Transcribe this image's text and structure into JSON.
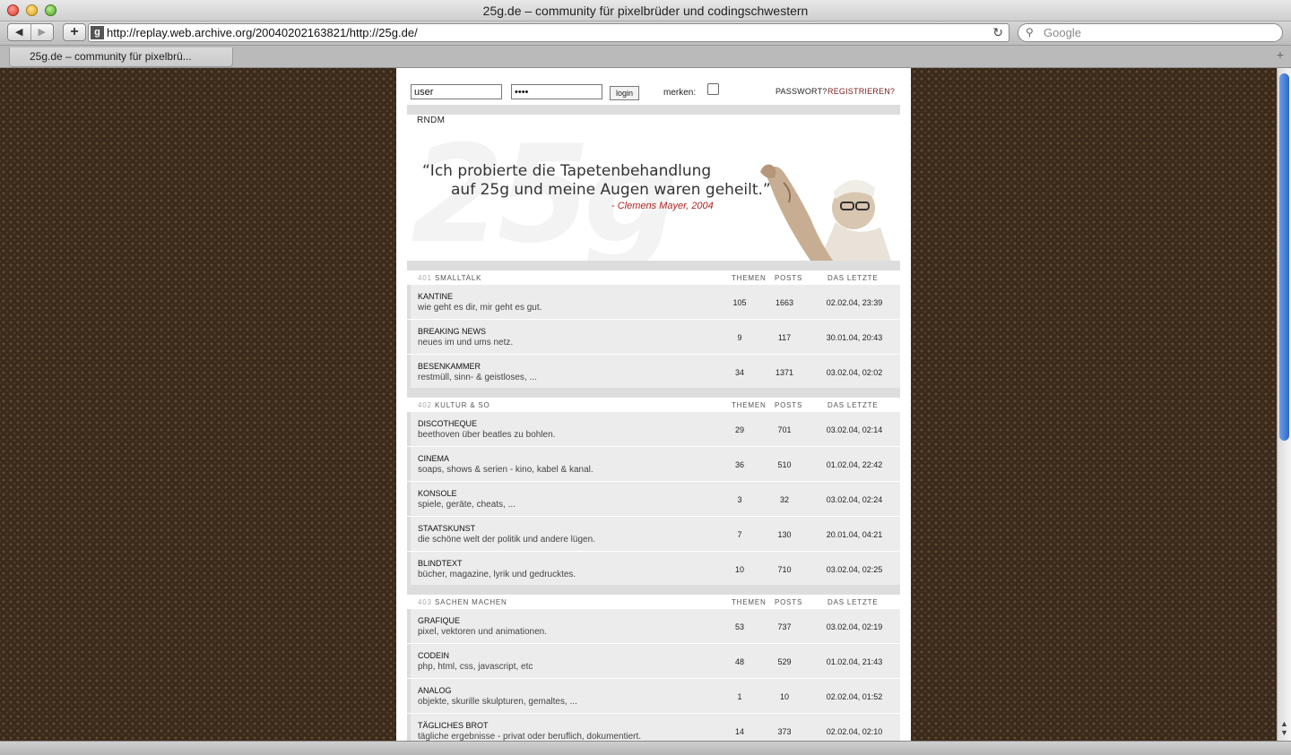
{
  "window": {
    "title": "25g.de – community für pixelbrüder und codingschwestern"
  },
  "toolbar": {
    "back_icon": "◀",
    "forward_icon": "▶",
    "add_icon": "+",
    "favicon": "g",
    "url": "http://replay.web.archive.org/20040202163821/http://25g.de/",
    "reload_icon": "↻",
    "search_icon": "🔍",
    "search_placeholder": "Google"
  },
  "tab": {
    "label": "25g.de – community für pixelbrü...",
    "new_tab_icon": "+"
  },
  "login": {
    "username": "user",
    "password": "••••",
    "login_label": "login",
    "remember_label": "merken:",
    "password_link": "PASSWORT?",
    "register_link": "REGISTRIEREN?"
  },
  "rndm_label": "RNDM",
  "hero": {
    "quote_line1": "“Ich probierte die Tapetenbehandlung",
    "quote_line2": "auf 25g und meine Augen waren geheilt.”",
    "author": "- Clemens Mayer, 2004"
  },
  "columns": {
    "themen": "THEMEN",
    "posts": "POSTS",
    "last": "DAS LETZTE"
  },
  "sections": [
    {
      "num": "401",
      "name": "SMALLTALK",
      "forums": [
        {
          "title": "KANTINE",
          "desc": "wie geht es dir, mir geht es gut.",
          "themen": "105",
          "posts": "1663",
          "last": "02.02.04, 23:39"
        },
        {
          "title": "BREAKING NEWS",
          "desc": "neues im und ums netz.",
          "themen": "9",
          "posts": "117",
          "last": "30.01.04, 20:43"
        },
        {
          "title": "BESENKAMMER",
          "desc": "restmüll, sinn- & geistloses, ...",
          "themen": "34",
          "posts": "1371",
          "last": "03.02.04, 02:02"
        }
      ]
    },
    {
      "num": "402",
      "name": "KULTUR & SO",
      "forums": [
        {
          "title": "DISCOTHEQUE",
          "desc": "beethoven über beatles zu bohlen.",
          "themen": "29",
          "posts": "701",
          "last": "03.02.04, 02:14"
        },
        {
          "title": "CINEMA",
          "desc": "soaps, shows & serien - kino, kabel & kanal.",
          "themen": "36",
          "posts": "510",
          "last": "01.02.04, 22:42"
        },
        {
          "title": "KONSOLE",
          "desc": "spiele, geräte, cheats, ...",
          "themen": "3",
          "posts": "32",
          "last": "03.02.04, 02:24"
        },
        {
          "title": "STAATSKUNST",
          "desc": "die schöne welt der politik und andere lügen.",
          "themen": "7",
          "posts": "130",
          "last": "20.01.04, 04:21"
        },
        {
          "title": "BLINDTEXT",
          "desc": "bücher, magazine, lyrik und gedrucktes.",
          "themen": "10",
          "posts": "710",
          "last": "03.02.04, 02:25"
        }
      ]
    },
    {
      "num": "403",
      "name": "SACHEN MACHEN",
      "forums": [
        {
          "title": "GRAFIQUE",
          "desc": "pixel, vektoren und animationen.",
          "themen": "53",
          "posts": "737",
          "last": "03.02.04, 02:19"
        },
        {
          "title": "CODEIN",
          "desc": "php, html, css, javascript, etc",
          "themen": "48",
          "posts": "529",
          "last": "01.02.04, 21:43"
        },
        {
          "title": "ANALOG",
          "desc": "objekte, skurille skulpturen, gemaltes, ...",
          "themen": "1",
          "posts": "10",
          "last": "02.02.04, 01:52"
        },
        {
          "title": "TÄGLICHES BROT",
          "desc": "tägliche ergebnisse - privat oder beruflich, dokumentiert.",
          "themen": "14",
          "posts": "373",
          "last": "02.02.04, 02:10"
        }
      ]
    }
  ]
}
